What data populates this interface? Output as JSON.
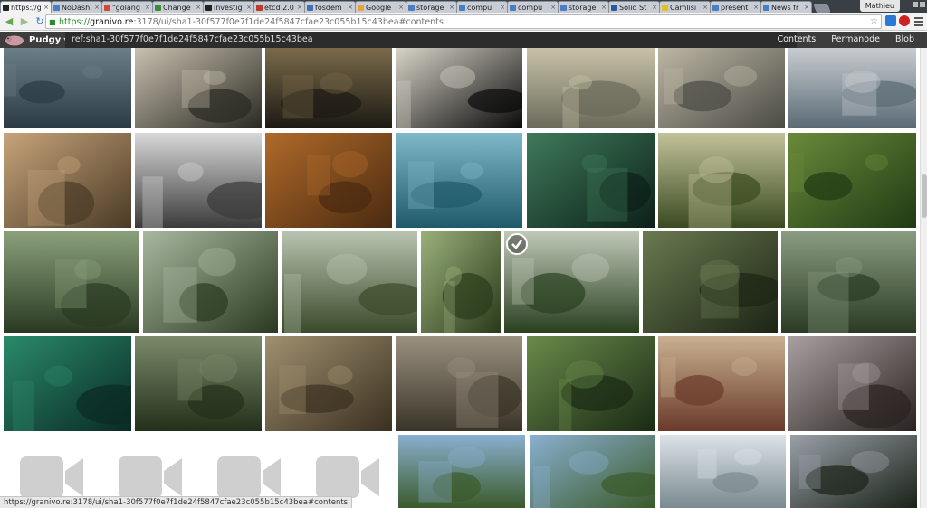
{
  "browser": {
    "tabs": [
      {
        "label": "https://g",
        "color": "#222222",
        "active": true
      },
      {
        "label": "NoDash",
        "color": "#4a7ec0",
        "active": false
      },
      {
        "label": "\"golang",
        "color": "#d44638",
        "active": false
      },
      {
        "label": "Change",
        "color": "#3b8a3b",
        "active": false
      },
      {
        "label": "investig",
        "color": "#222222",
        "active": false
      },
      {
        "label": "etcd 2.0",
        "color": "#c0392b",
        "active": false
      },
      {
        "label": "fosdem",
        "color": "#3f6fb5",
        "active": false
      },
      {
        "label": "Google",
        "color": "#e8a33a",
        "active": false
      },
      {
        "label": "storage",
        "color": "#4a7ec0",
        "active": false
      },
      {
        "label": "compu",
        "color": "#4a7ec0",
        "active": false
      },
      {
        "label": "compu",
        "color": "#4a7ec0",
        "active": false
      },
      {
        "label": "storage",
        "color": "#4a7ec0",
        "active": false
      },
      {
        "label": "Solid St",
        "color": "#2b5aa5",
        "active": false
      },
      {
        "label": "Camlisi",
        "color": "#e3c21b",
        "active": false
      },
      {
        "label": "present",
        "color": "#4a7ec0",
        "active": false
      },
      {
        "label": "News fr",
        "color": "#4a7ec0",
        "active": false
      }
    ],
    "tab_close_glyph": "×",
    "user_name": "Mathieu",
    "url_protocol": "https://",
    "url_host": "granivo.re",
    "url_rest": ":3178/ui/sha1-30f577f0e7f1de24f5847cfae23c055b15c43bea#contents"
  },
  "app": {
    "brand": "Pudgy",
    "brand_caret": "▼",
    "ref": "ref:sha1-30f577f0e7f1de24f5847cfae23c055b15c43bea",
    "nav": [
      "Contents",
      "Permanode",
      "Blob"
    ]
  },
  "gallery": {
    "selected_index": 18,
    "video_tile_count": 4,
    "rows": [
      {
        "palette": [
          [
            "#2b3a44",
            "#6b7f88"
          ],
          [
            "#2a2a22",
            "#c8c0b0"
          ],
          [
            "#1c1a14",
            "#7a6a4a"
          ],
          [
            "#0a0a0a",
            "#d8d4c8"
          ],
          [
            "#6a6a5a",
            "#c9c2a8"
          ],
          [
            "#4a4a44",
            "#bcb6a4"
          ],
          [
            "#5a6a74",
            "#c8ccd0"
          ]
        ]
      },
      {
        "palette": [
          [
            "#4a3a26",
            "#c7a47a"
          ],
          [
            "#3b3b3b",
            "#d8d8d8"
          ],
          [
            "#4a2a10",
            "#b06a2a"
          ],
          [
            "#1f5a6a",
            "#7fb8c8"
          ],
          [
            "#0c2018",
            "#3f7a5a"
          ],
          [
            "#3a4a20",
            "#c2c29a"
          ],
          [
            "#203a14",
            "#6a8a3a"
          ]
        ]
      },
      {
        "palette": [
          [
            "#2a3a22",
            "#8aa07a"
          ],
          [
            "#2a3a20",
            "#a8b8a0"
          ],
          [
            "#3a4a2a",
            "#b8c4b0"
          ],
          [
            "#2a3a1a",
            "#9ab07a"
          ],
          [
            "#2a4020",
            "#c0c8b8"
          ],
          [
            "#1c2414",
            "#6a7a50"
          ],
          [
            "#2a3a24",
            "#8a9c80"
          ]
        ]
      },
      {
        "palette": [
          [
            "#0a2a24",
            "#2a8a6a"
          ],
          [
            "#22301a",
            "#7a8a6a"
          ],
          [
            "#3a3020",
            "#a09070"
          ],
          [
            "#3a3428",
            "#9a9080"
          ],
          [
            "#1a2a14",
            "#6a8a4a"
          ],
          [
            "#6a3a2a",
            "#c8b090"
          ],
          [
            "#2a2220",
            "#a8a0a0"
          ]
        ]
      },
      {
        "palette": [
          [
            "#3a5a2a",
            "#8ab0d0"
          ],
          [
            "#3a5a2a",
            "#8ab0d0"
          ],
          [
            "#7a8a90",
            "#dde3e8"
          ],
          [
            "#1a2218",
            "#9aa0a8"
          ]
        ]
      }
    ]
  }
}
